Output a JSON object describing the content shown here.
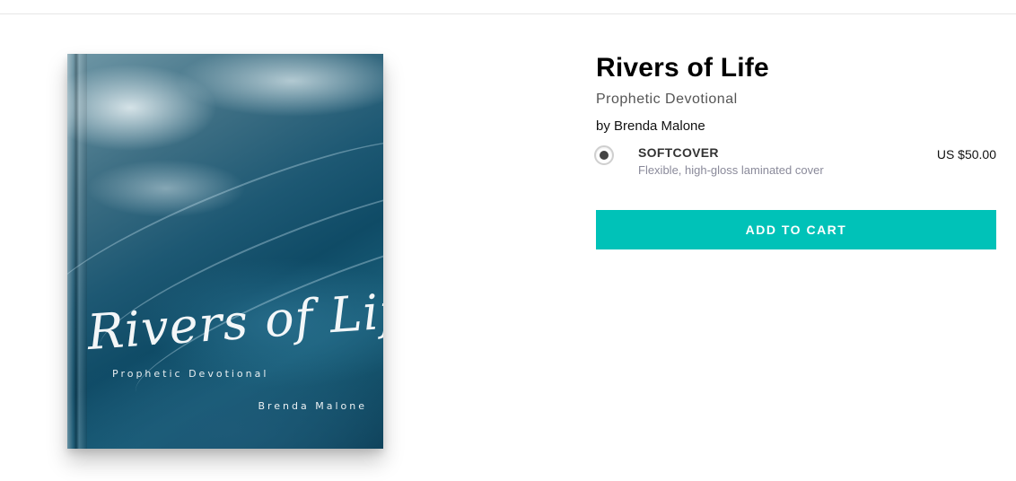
{
  "product": {
    "title": "Rivers of Life",
    "subtitle": "Prophetic Devotional",
    "author_line": "by Brenda Malone",
    "cover": {
      "title_text": "Rivers of Life",
      "subtitle_text": "Prophetic Devotional",
      "author_text": "Brenda Malone"
    },
    "options": [
      {
        "name": "SOFTCOVER",
        "description": "Flexible, high-gloss laminated cover",
        "price": "US $50.00",
        "selected": true
      }
    ],
    "cta_label": "ADD TO CART"
  },
  "colors": {
    "accent": "#00c2b8"
  }
}
